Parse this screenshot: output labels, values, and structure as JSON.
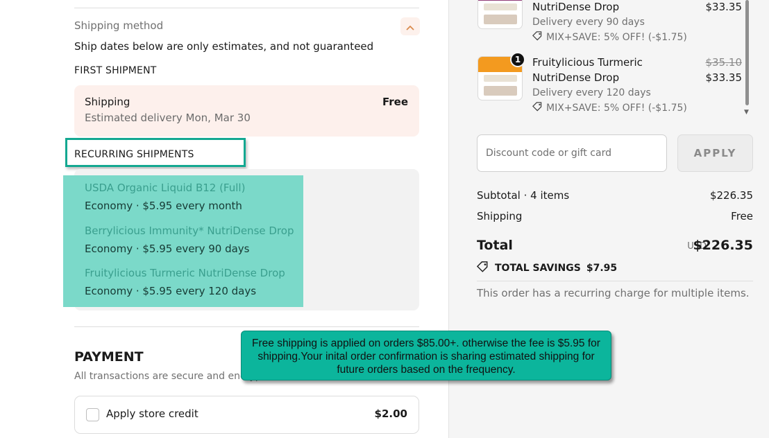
{
  "shipping_method": {
    "label": "Shipping method",
    "note": "Ship dates below are only estimates, and not guaranteed"
  },
  "first_shipment": {
    "heading": "FIRST SHIPMENT",
    "title": "Shipping",
    "estimate": "Estimated delivery Mon, Mar 30",
    "price": "Free"
  },
  "recurring_shipments": {
    "heading": "RECURRING SHIPMENTS",
    "items": [
      {
        "name": "USDA Organic Liquid B12 (Full)",
        "detail": "Economy · $5.95 every month"
      },
      {
        "name": "Berrylicious Immunity* NutriDense Drop",
        "detail": "Economy · $5.95 every 90 days"
      },
      {
        "name": "Fruitylicious Turmeric NutriDense Drop",
        "detail": "Economy · $5.95 every 120 days"
      }
    ]
  },
  "payment": {
    "title": "PAYMENT",
    "subtitle": "All transactions are secure and encrypted.",
    "store_credit_label": "Apply store credit",
    "store_credit_amount": "$2.00"
  },
  "cart": {
    "items": [
      {
        "name_line2": "NutriDense Drop",
        "price": "$33.35",
        "delivery": "Delivery every 90 days",
        "promo": "MIX+SAVE: 5% OFF! (-$1.75)",
        "thumb_color": "#8e3a76"
      },
      {
        "name_line1": "Fruitylicious Turmeric",
        "name_line2": "NutriDense Drop",
        "old_price": "$35.10",
        "price": "$33.35",
        "delivery": "Delivery every 120 days",
        "promo": "MIX+SAVE: 5% OFF! (-$1.75)",
        "quantity": "1",
        "thumb_color": "#f39a1f"
      }
    ]
  },
  "discount": {
    "placeholder": "Discount code or gift card",
    "apply_label": "APPLY"
  },
  "summary": {
    "subtotal_label": "Subtotal · 4 items",
    "subtotal_value": "$226.35",
    "shipping_label": "Shipping",
    "shipping_value": "Free",
    "total_label": "Total",
    "currency": "USD",
    "total_value": "$226.35",
    "savings_label": "TOTAL SAVINGS",
    "savings_value": "$7.95",
    "recurring_note": "This order has a recurring charge for multiple items."
  },
  "callout": {
    "text": "Free shipping is applied on orders $85.00+.  otherwise the fee is $5.95 for shipping.Your inital order confirmation is sharing estimated shipping for future orders based on the frequency."
  },
  "colors": {
    "accent_teal": "#0cb59c",
    "highlight_teal": "#7bd9c9",
    "first_box_bg": "#fdf0ec"
  }
}
